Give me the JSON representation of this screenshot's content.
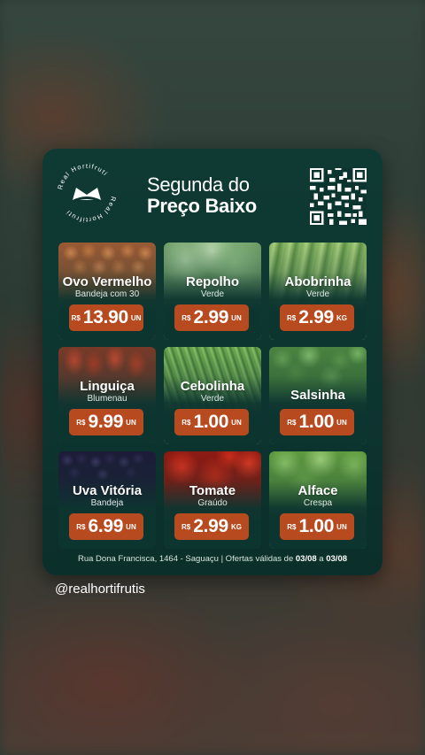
{
  "header": {
    "logo_ring_text": "Real Hortifruti",
    "title_line1": "Segunda do",
    "title_line2": "Preço Baixo"
  },
  "products": [
    {
      "name": "Ovo Vermelho",
      "desc": "Bandeja com 30",
      "currency": "R$",
      "price": "13.90",
      "unit": "UN"
    },
    {
      "name": "Repolho",
      "desc": "Verde",
      "currency": "R$",
      "price": "2.99",
      "unit": "UN"
    },
    {
      "name": "Abobrinha",
      "desc": "Verde",
      "currency": "R$",
      "price": "2.99",
      "unit": "KG"
    },
    {
      "name": "Linguiça",
      "desc": "Blumenau",
      "currency": "R$",
      "price": "9.99",
      "unit": "UN"
    },
    {
      "name": "Cebolinha",
      "desc": "Verde",
      "currency": "R$",
      "price": "1.00",
      "unit": "UN"
    },
    {
      "name": "Salsinha",
      "desc": "",
      "currency": "R$",
      "price": "1.00",
      "unit": "UN"
    },
    {
      "name": "Uva Vitória",
      "desc": "Bandeja",
      "currency": "R$",
      "price": "6.99",
      "unit": "UN"
    },
    {
      "name": "Tomate",
      "desc": "Graúdo",
      "currency": "R$",
      "price": "2.99",
      "unit": "KG"
    },
    {
      "name": "Alface",
      "desc": "Crespa",
      "currency": "R$",
      "price": "1.00",
      "unit": "UN"
    }
  ],
  "footer": {
    "address": "Rua Dona Francisca, 1464 - Saguaçu | Ofertas válidas de ",
    "date_from": "03/08",
    "connector": " a ",
    "date_to": "03/08"
  },
  "handle": "@realhortifrutis",
  "colors": {
    "card_bg": "#0d3530",
    "price_tag": "#b84a1f",
    "text": "#ffffff"
  },
  "icons": [
    "crown-logo-icon",
    "qr-code-icon"
  ]
}
